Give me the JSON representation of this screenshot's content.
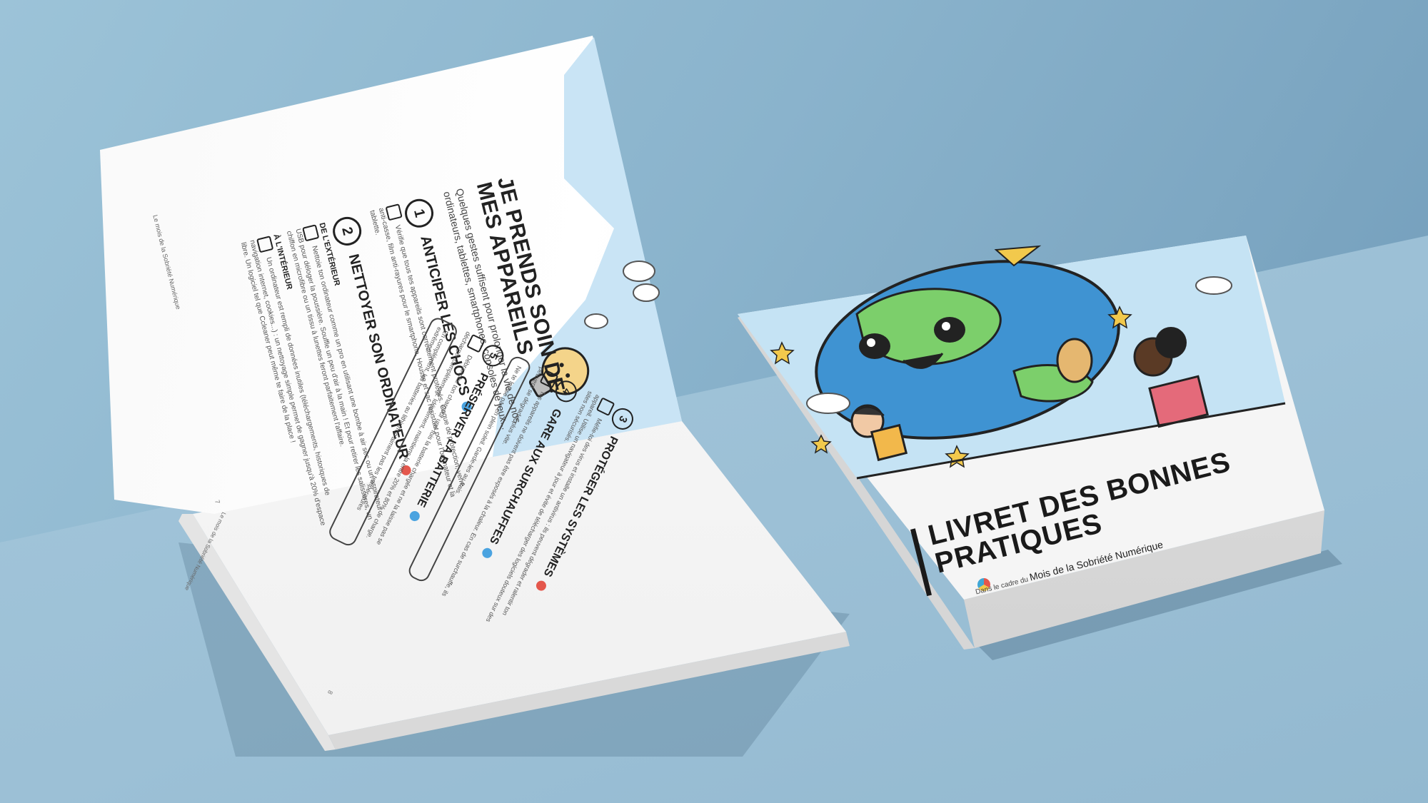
{
  "open_book": {
    "left_page": {
      "title_line1": "JE PRENDS SOIN DE",
      "title_line2": "MES APPAREILS",
      "intro": "Quelques gestes suffisent pour prolonger la vie de nos ordinateurs, tablettes, smartphones, consoles de jeux...",
      "item1": {
        "number": "1",
        "title": "ANTICIPER LES CHOCS",
        "text": "Vérifie que tous tes appareils sont correctement protégés. Coque de protection, verre anti-casse, film anti-rayures pour le smartphone. Housse et sac résistant pour l'ordinateur et la tablette."
      },
      "item2": {
        "number": "2",
        "title": "NETTOYER SON ORDINATEUR",
        "exterior_title": "DE L'EXTÉRIEUR",
        "exterior_text": "Nettoie ton ordinateur comme un pro en utilisant une bombe à air sec ou un aspirateur USB pour déloger la poussière. Souffle un peu d'air à la main ! Et pour retirer les salissures, un chiffon en microfibre ou un tissu à lunettes feront parfaitement l'affaire.",
        "interior_title": "À L'INTÉRIEUR",
        "interior_text": "Un ordinateur est rempli de données inutiles (téléchargements, historiques de navigation internet, cookies...) : un nettoyage simple permet de gagner jusqu'à 20% d'espace libre. Un logiciel tel que Ccleaner peut même te faire de la place !"
      },
      "footer": "Le mois de la Sobriété Numérique",
      "page_number": "7"
    },
    "right_page": {
      "item3": {
        "number": "3",
        "title": "PROTÉGER LES SYSTÈMES",
        "text": "Méfie-toi des virus et installe un antivirus : ils peuvent dégrader et ralentir ton appareil. Utilise un navigateur à jour et évite de télécharger des logiciels douteux sur des sites non sécurisés."
      },
      "item4": {
        "number": "4",
        "title": "GARE AUX SURCHAUFFES",
        "text": "Tes appareils ne doivent pas être exposés à la chaleur. En cas de surchauffe, ils peuvent se dégrader plus vite.",
        "note": "Ne te laisse pas en plein soleil. Garde-les au frais."
      },
      "item5": {
        "number": "5",
        "title": "PRÉSERVER LA BATTERIE",
        "text": "Débranche ton chargeur une fois la batterie chargée et ne la laisse pas se décharger complètement. Idéalement, maintiens-la entre 20% et 80% de charge.",
        "note": "En complément, les batteries au lithium n'aiment pas les températures extrêmes."
      },
      "footer": "Le mois de la Sobriété Numérique",
      "page_number": "8"
    }
  },
  "closed_book": {
    "title_line1": "LIVRET DES BONNES",
    "title_line2": "PRATIQUES",
    "subtitle_prefix": "Dans le cadre du",
    "subtitle_main": "Mois de la Sobriété Numérique"
  },
  "colors": {
    "sky": "#c5e3f4",
    "earth_water": "#3f93d2",
    "earth_land": "#7ccf6b",
    "ink": "#1a1a1a",
    "badge_blue": "#4aa3e0",
    "badge_red": "#e4574c"
  }
}
